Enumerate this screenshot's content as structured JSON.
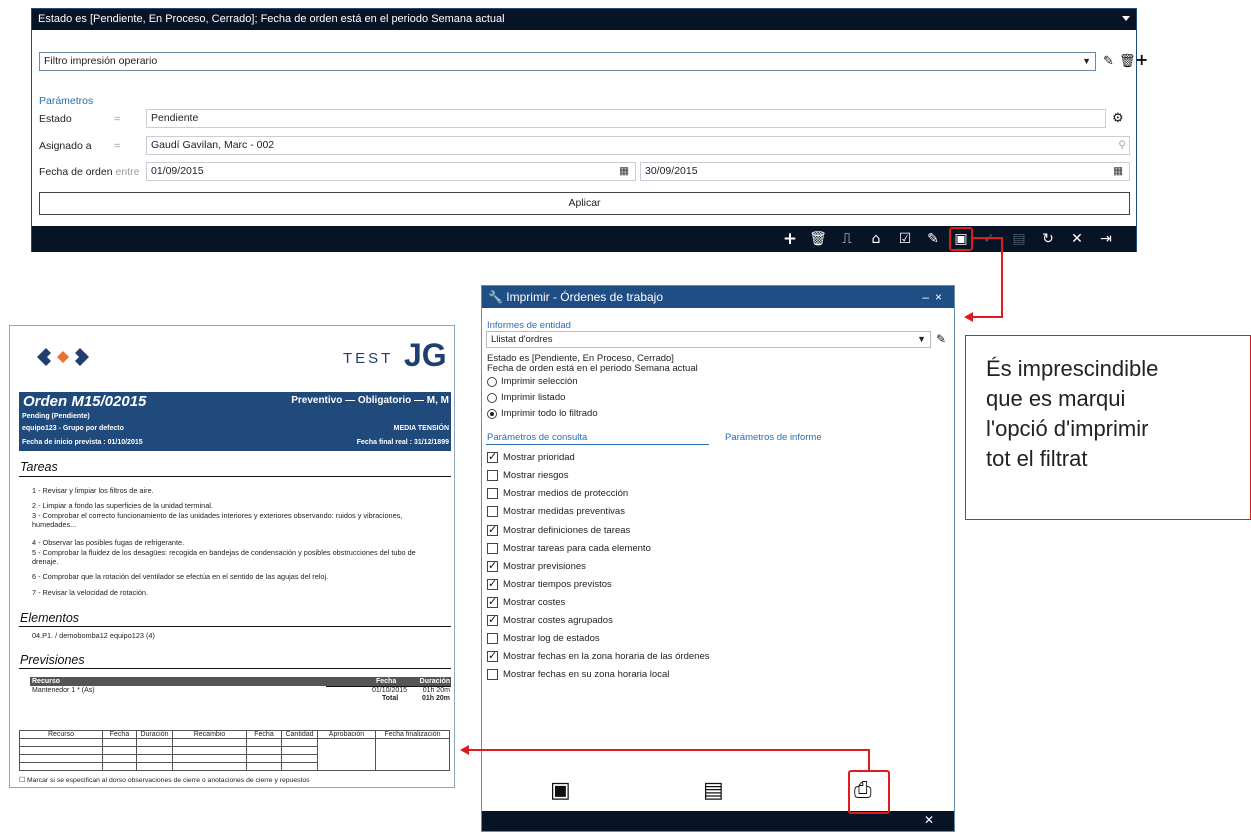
{
  "filter_panel": {
    "header": "Estado es [Pendiente, En Proceso, Cerrado]; Fecha de orden está en el periodo Semana actual",
    "filter_select": "Filtro impresión operario",
    "params_title": "Parámetros",
    "estado_label": "Estado",
    "estado_value": "Pendiente",
    "asignado_label": "Asignado a",
    "asignado_value": "Gaudí Gavilan, Marc - 002",
    "fecha_label": "Fecha de orden",
    "fecha_between": "entre",
    "fecha_from": "01/09/2015",
    "fecha_to": "30/09/2015",
    "equals": "=",
    "apply_label": "Aplicar"
  },
  "dialog": {
    "title": "Imprimir -  Órdenes de trabajo",
    "informes_label": "Informes de entidad",
    "informe_value": "Llistat d'ordres",
    "filter_desc_1": "Estado es [Pendiente, En Proceso, Cerrado]",
    "filter_desc_2": "Fecha de orden está en el periodo Semana actual",
    "radios": [
      {
        "label": "Imprimir selección",
        "checked": false
      },
      {
        "label": "Imprimir listado",
        "checked": false
      },
      {
        "label": "Imprimir todo lo filtrado",
        "checked": true
      }
    ],
    "tab_consulta": "Parámetros de consulta",
    "tab_informe": "Parámetros de informe",
    "options": [
      {
        "label": "Mostrar prioridad",
        "checked": true
      },
      {
        "label": "Mostrar riesgos",
        "checked": false
      },
      {
        "label": "Mostrar medios de protección",
        "checked": false
      },
      {
        "label": "Mostrar medidas preventivas",
        "checked": false
      },
      {
        "label": "Mostrar definiciones de tareas",
        "checked": true
      },
      {
        "label": "Mostrar tareas para cada elemento",
        "checked": false
      },
      {
        "label": "Mostrar previsiones",
        "checked": true
      },
      {
        "label": "Mostrar tiempos previstos",
        "checked": true
      },
      {
        "label": "Mostrar costes",
        "checked": true
      },
      {
        "label": "Mostrar costes agrupados",
        "checked": true
      },
      {
        "label": "Mostrar log de estados",
        "checked": false
      },
      {
        "label": "Mostrar fechas en la zona horaria de las órdenes",
        "checked": true
      },
      {
        "label": "Mostrar fechas en su zona horaria local",
        "checked": false
      }
    ]
  },
  "callout": {
    "lines": [
      "És imprescindible",
      "que es marqui",
      "l'opció d'imprimir",
      "tot el filtrat"
    ]
  },
  "report": {
    "brand_test": "TEST",
    "brand_jg": "JG",
    "order_title": "Orden M15/02015",
    "order_type": "Preventivo — Obligatorio  — M, M",
    "status": "Pending (Pendiente)",
    "group": "equipo123 - Grupo por defecto",
    "voltage": "MEDIA TENSIÓN",
    "start_date": "Fecha de inicio prevista : 01/10/2015",
    "end_date": "Fecha final real : 31/12/1899",
    "tareas_title": "Tareas",
    "tasks": [
      "1 - Revisar y limpiar los filtros de aire.",
      "2 - Limpiar a fondo las superficies de la unidad terminal.",
      "3 - Comprobar el correcto funcionamiento de las unidades interiores y exteriores observando: ruidos y vibraciones, humedades...",
      "4 - Observar las posibles fugas de refrigerante.",
      "5 - Comprobar la fluidez de los desagües: recogida en bandejas de condensación y posibles obstrucciones del tubo de drenaje.",
      "6 - Comprobar que la rotación del ventilador se efectúa en el sentido de las agujas del reloj.",
      "7 - Revisar la velocidad de rotación."
    ],
    "elementos_title": "Elementos",
    "element": "04.P1. / demobomba12 equipo123 (4)",
    "previsiones_title": "Previsiones",
    "rec_head_recurso": "Recurso",
    "rec_head_fecha": "Fecha",
    "rec_head_duracion": "Duración",
    "rec_name": "Mantenedor 1 * (As)",
    "rec_date": "01/10/2015",
    "rec_dur": "01h 20m",
    "total_label": "Total",
    "total_value": "01h 20m",
    "grid_headers": [
      "Recurso",
      "Fecha",
      "Duración",
      "Recambio",
      "Fecha",
      "Cantidad",
      "Aprobación",
      "Fecha finalización"
    ],
    "footer_note": "☐  Marcar si se especifican al dorso observaciones de cierre o anotaciones de cierre y repuestos"
  }
}
